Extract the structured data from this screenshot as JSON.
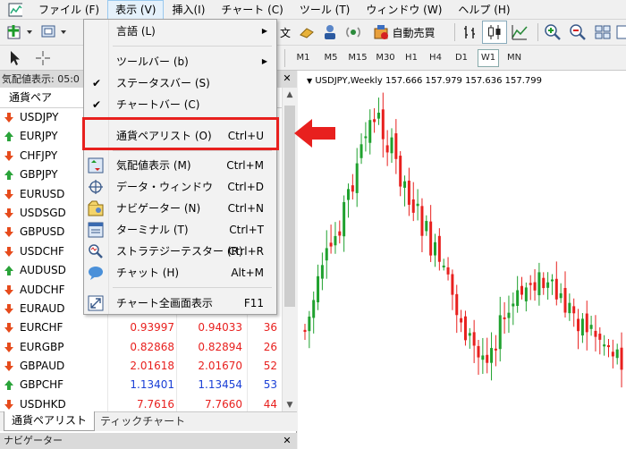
{
  "menubar": {
    "items": [
      {
        "label": "ファイル (F)"
      },
      {
        "label": "表示 (V)"
      },
      {
        "label": "挿入(I)"
      },
      {
        "label": "チャート (C)"
      },
      {
        "label": "ツール (T)"
      },
      {
        "label": "ウィンドウ (W)"
      },
      {
        "label": "ヘルプ (H)"
      }
    ]
  },
  "toolbar": {
    "autotrade_label": "自動売買",
    "timeframes": [
      "M1",
      "M5",
      "M15",
      "M30",
      "H1",
      "H4",
      "D1",
      "W1",
      "MN"
    ],
    "selected_timeframe": "W1",
    "partial_text": "文"
  },
  "view_menu": {
    "items": [
      {
        "label": "言語 (L)",
        "shortcut": "",
        "submenu": true
      },
      {
        "label": "ツールバー (b)",
        "shortcut": "",
        "submenu": true
      },
      {
        "label": "ステータスバー (S)",
        "shortcut": "",
        "checked": true
      },
      {
        "label": "チャートバー (C)",
        "shortcut": "",
        "checked": true
      },
      {
        "label": "通貨ペアリスト (O)",
        "shortcut": "Ctrl+U",
        "highlighted": true
      },
      {
        "label": "気配値表示 (M)",
        "shortcut": "Ctrl+M",
        "icon": "market-watch-icon"
      },
      {
        "label": "データ・ウィンドウ",
        "shortcut": "Ctrl+D",
        "icon": "crosshair-icon"
      },
      {
        "label": "ナビゲーター (N)",
        "shortcut": "Ctrl+N",
        "icon": "navigator-icon"
      },
      {
        "label": "ターミナル (T)",
        "shortcut": "Ctrl+T",
        "icon": "terminal-icon"
      },
      {
        "label": "ストラテジーテスター (R)",
        "shortcut": "Ctrl+R",
        "icon": "tester-icon"
      },
      {
        "label": "チャット (H)",
        "shortcut": "Alt+M",
        "icon": "chat-icon"
      },
      {
        "label": "チャート全画面表示",
        "shortcut": "F11",
        "icon": "fullscreen-icon"
      }
    ]
  },
  "market_watch": {
    "title": "気配値表示: 05:0",
    "column_header": "通貨ペア",
    "rows": [
      {
        "symbol": "USDJPY",
        "dir": "down",
        "bid": "",
        "ask": "",
        "spread": ""
      },
      {
        "symbol": "EURJPY",
        "dir": "up",
        "bid": "",
        "ask": "",
        "spread": ""
      },
      {
        "symbol": "CHFJPY",
        "dir": "down",
        "bid": "",
        "ask": "",
        "spread": ""
      },
      {
        "symbol": "GBPJPY",
        "dir": "up",
        "bid": "",
        "ask": "",
        "spread": ""
      },
      {
        "symbol": "EURUSD",
        "dir": "down",
        "bid": "",
        "ask": "",
        "spread": ""
      },
      {
        "symbol": "USDSGD",
        "dir": "down",
        "bid": "",
        "ask": "",
        "spread": ""
      },
      {
        "symbol": "GBPUSD",
        "dir": "down",
        "bid": "",
        "ask": "",
        "spread": ""
      },
      {
        "symbol": "USDCHF",
        "dir": "down",
        "bid": "",
        "ask": "",
        "spread": ""
      },
      {
        "symbol": "AUDUSD",
        "dir": "up",
        "bid": "",
        "ask": "",
        "spread": ""
      },
      {
        "symbol": "AUDCHF",
        "dir": "down",
        "bid": "",
        "ask": "",
        "spread": ""
      },
      {
        "symbol": "EURAUD",
        "dir": "down",
        "bid": "",
        "ask": "",
        "spread": ""
      },
      {
        "symbol": "EURCHF",
        "dir": "down",
        "bid": "0.93997",
        "ask": "0.94033",
        "spread": "36",
        "color": "#e8201e"
      },
      {
        "symbol": "EURGBP",
        "dir": "down",
        "bid": "0.82868",
        "ask": "0.82894",
        "spread": "26",
        "color": "#e8201e"
      },
      {
        "symbol": "GBPAUD",
        "dir": "down",
        "bid": "2.01618",
        "ask": "2.01670",
        "spread": "52",
        "color": "#e8201e"
      },
      {
        "symbol": "GBPCHF",
        "dir": "up",
        "bid": "1.13401",
        "ask": "1.13454",
        "spread": "53",
        "color": "#1a3fd6"
      },
      {
        "symbol": "USDHKD",
        "dir": "down",
        "bid": "7.7616",
        "ask": "7.7660",
        "spread": "44",
        "color": "#e8201e"
      }
    ],
    "tabs": [
      "通貨ペアリスト",
      "ティックチャート"
    ]
  },
  "navigator": {
    "title": "ナビゲーター"
  },
  "chart": {
    "legend": "USDJPY,Weekly  157.666 157.979 157.636 157.799",
    "bull_color": "#1fa12e",
    "bear_color": "#e8201e"
  },
  "colors": {
    "up_arrow": "#2aa33a",
    "down_arrow": "#e64b1c",
    "highlight_box": "#e8201e"
  }
}
